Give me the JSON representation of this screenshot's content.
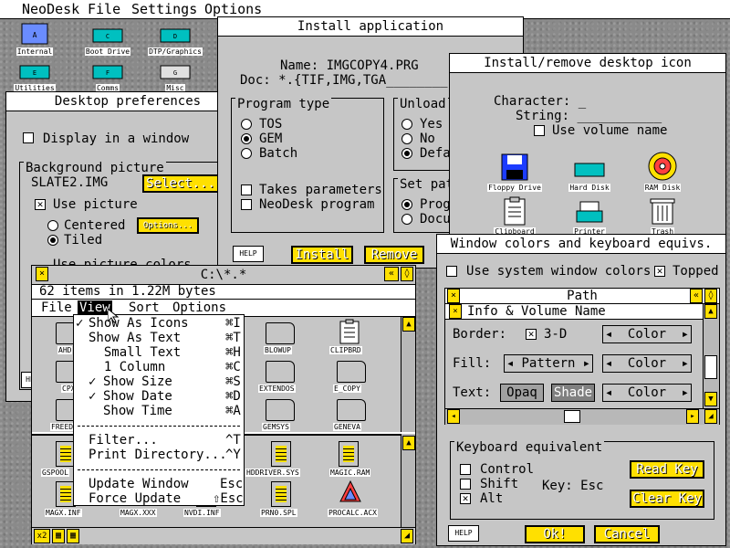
{
  "menubar": {
    "items": [
      "NeoDesk",
      "File",
      "Settings",
      "Options"
    ]
  },
  "desktop_icons": [
    {
      "label": "Internal"
    },
    {
      "label": "Boot Drive"
    },
    {
      "label": "DTP/Graphics"
    },
    {
      "label": "Utilities"
    },
    {
      "label": "Comms"
    },
    {
      "label": "Misc"
    }
  ],
  "install_app": {
    "title": "Install application",
    "name_label": "Name:",
    "name_value": "IMGCOPY4.PRG",
    "doc_label": "Doc:",
    "doc_value": "*.{TIF,IMG,TGA________}",
    "program_type": {
      "title": "Program type",
      "options": [
        "TOS",
        "GEM",
        "Batch"
      ],
      "selected": "GEM"
    },
    "takes_parameters": "Takes parameters",
    "neodesk_program": "NeoDesk program",
    "unload": {
      "title": "Unload",
      "options": [
        "Yes",
        "No",
        "Defa"
      ]
    },
    "set_path": {
      "title": "Set pat",
      "options": [
        "Prog",
        "Docu"
      ]
    },
    "help": "HELP",
    "install": "Install",
    "remove": "Remove"
  },
  "install_icon": {
    "title": "Install/remove desktop icon",
    "character_label": "Character:",
    "character_value": "_",
    "string_label": "String:",
    "string_value": "___________",
    "use_volume_name": "Use volume name",
    "icons": [
      "Floppy Drive",
      "Hard Disk",
      "RAM Disk",
      "Clipboard",
      "Printer",
      "Trash"
    ]
  },
  "desktop_prefs": {
    "title": "Desktop preferences",
    "display_in_window": "Display in a window",
    "background": {
      "title": "Background picture",
      "file": "SLATE2.IMG",
      "select": "Select...",
      "use_picture": "Use picture",
      "centered": "Centered",
      "tiled": "Tiled",
      "options": "Options...",
      "use_colors": "Use picture colors"
    },
    "help": "HE"
  },
  "file_window": {
    "title": "C:\\*.*",
    "info": "62 items in 1.22M bytes",
    "menu": [
      "File",
      "View",
      "Sort",
      "Options"
    ],
    "files_top": [
      "AHD",
      "BLOWUP",
      "CLIPBRD",
      "CPX",
      "EXTENDOS",
      "E_COPY",
      "FREED",
      "GEMSYS",
      "GENEVA"
    ],
    "files_bottom": [
      "GSPOOL",
      "HDDRIVER.SYS",
      "MAGIC.RAM",
      "MAGX.INF",
      "MAGX.XXX",
      "NVDI.INF",
      "PRN0.SPL",
      "PROCALC.ACX"
    ],
    "bottom_label": "x2"
  },
  "view_menu": {
    "items": [
      {
        "check": "✓",
        "label": "Show As Icons",
        "key": "⌘I"
      },
      {
        "check": "",
        "label": "Show As Text",
        "key": "⌘T"
      },
      {
        "check": "",
        "label": "  Small Text",
        "key": "⌘H"
      },
      {
        "check": "",
        "label": "  1 Column",
        "key": "⌘C"
      },
      {
        "check": "✓",
        "label": "Show Size",
        "key": "⌘S"
      },
      {
        "check": "✓",
        "label": "Show Date",
        "key": "⌘D"
      },
      {
        "check": "",
        "label": "Show Time",
        "key": "⌘A"
      },
      {
        "check": "",
        "label": "Filter...",
        "key": "^T"
      },
      {
        "check": "",
        "label": "Print Directory...",
        "key": "^Y"
      },
      {
        "check": "",
        "label": "Update Window",
        "key": "Esc"
      },
      {
        "check": "",
        "label": "Force Update",
        "key": "⇧Esc"
      }
    ]
  },
  "wcolors": {
    "title": "Window colors and keyboard equivs.",
    "use_system": "Use system window colors",
    "topped": "Topped",
    "path": "Path",
    "info_volume": "Info & Volume Name",
    "border_label": "Border:",
    "border_3d": "3-D",
    "color": "Color",
    "fill_label": "Fill:",
    "pattern": "Pattern",
    "text_label": "Text:",
    "opaq": "Opaq",
    "shade": "Shade",
    "keyboard": {
      "title": "Keyboard equivalent",
      "control": "Control",
      "shift": "Shift",
      "alt": "Alt",
      "key_label": "Key:",
      "key_value": "Esc",
      "read_key": "Read Key",
      "clear_key": "Clear Key"
    },
    "help": "HELP",
    "ok": "Ok!",
    "cancel": "Cancel"
  }
}
